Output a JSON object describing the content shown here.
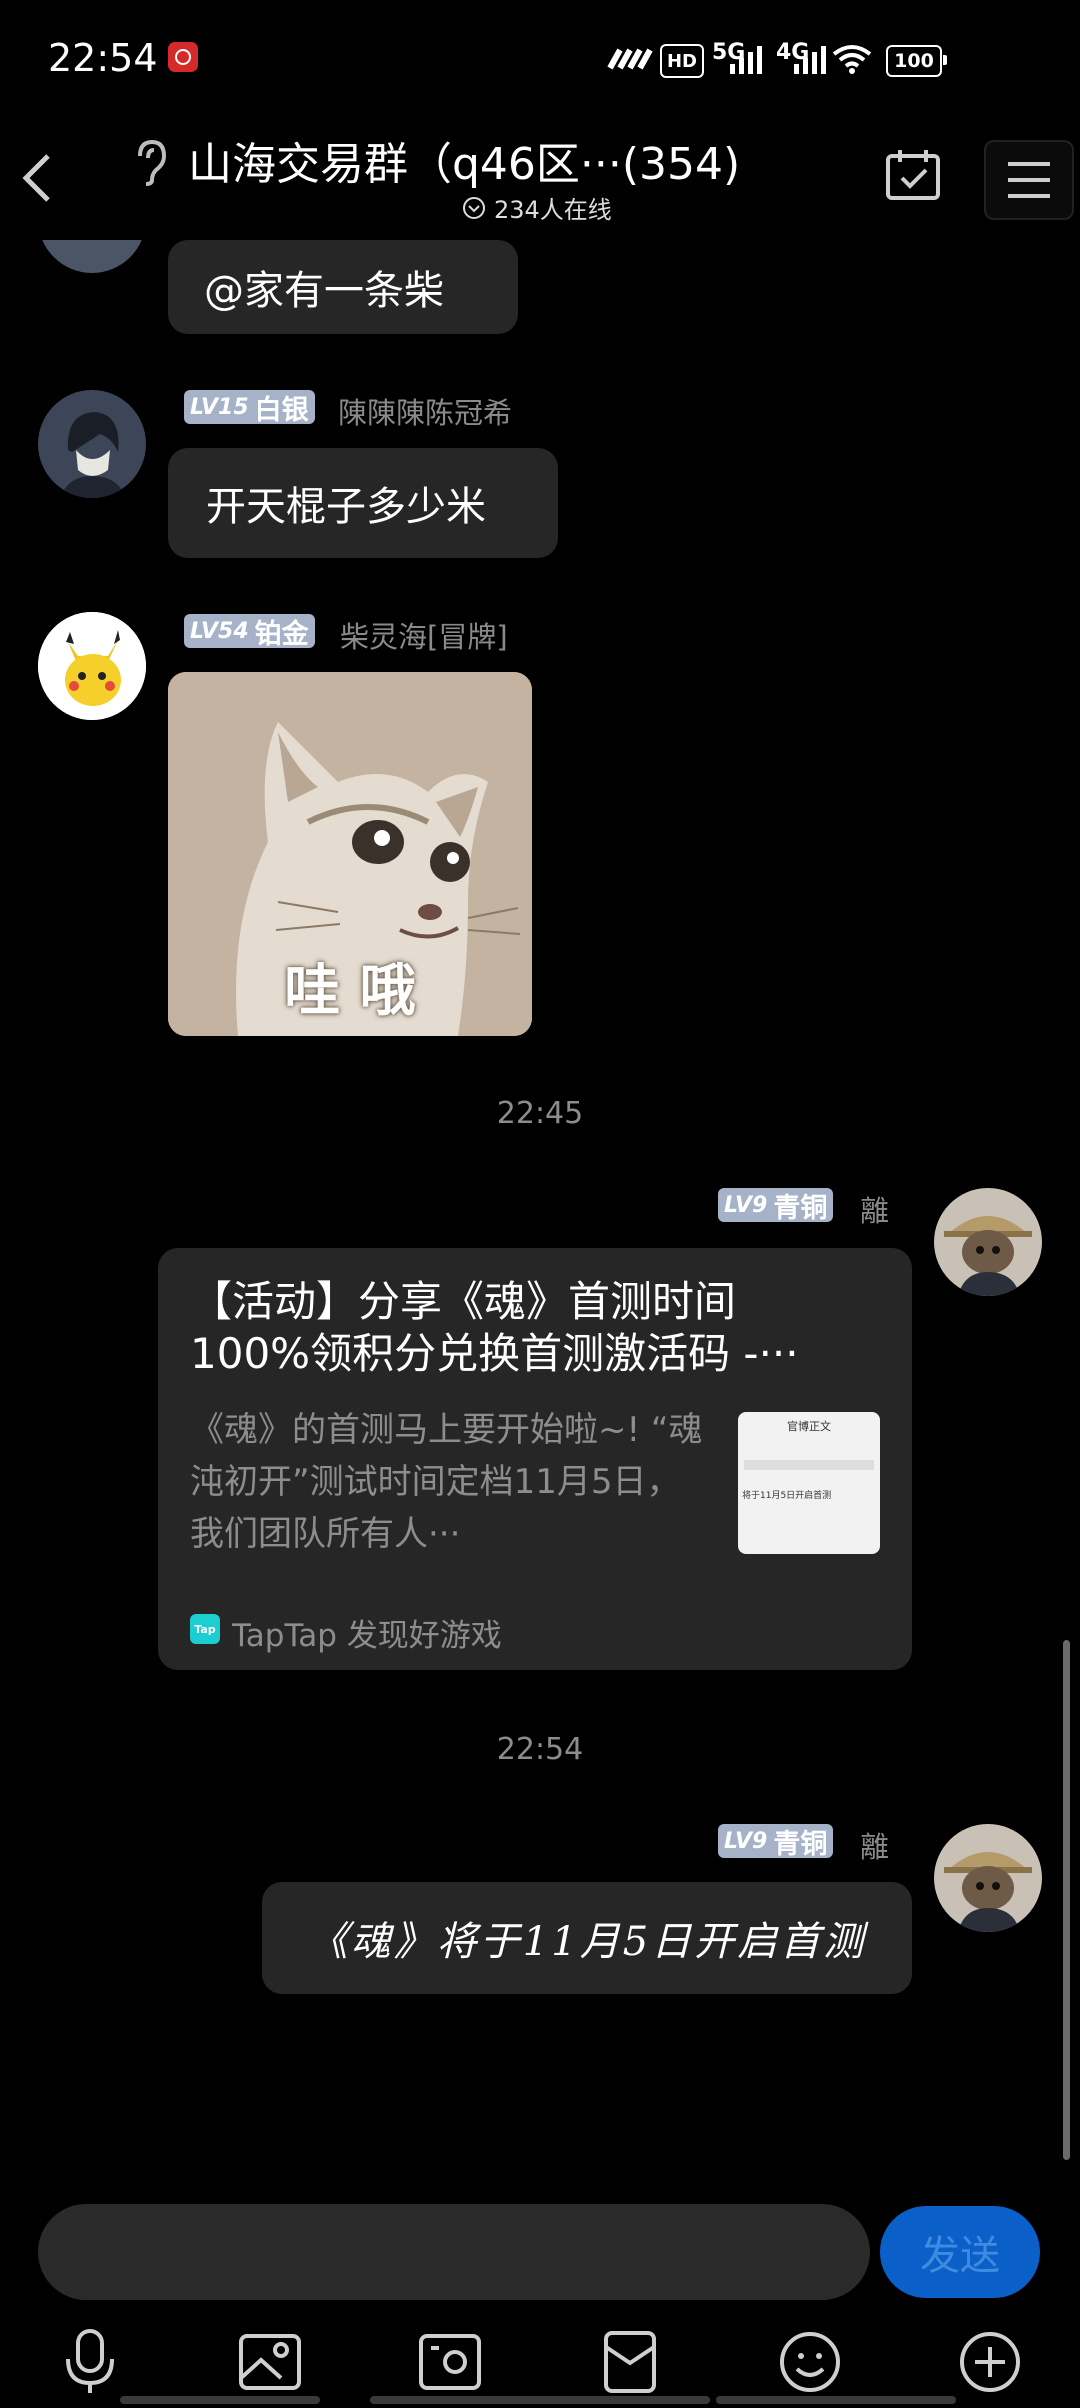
{
  "status_bar": {
    "time": "22:54",
    "network_hd": "HD",
    "network_5g": "5G",
    "network_4g": "4G",
    "battery": "100"
  },
  "header": {
    "title": "山海交易群（q46区···(354)",
    "online": "234人在线"
  },
  "messages": [
    {
      "text": "@家有一条柴"
    },
    {
      "level": "LV15",
      "rank": "白银",
      "nick": "陳陳陳陈冠希",
      "text": "开天棍子多少米"
    },
    {
      "level": "LV54",
      "rank": "铂金",
      "nick": "柴灵海[冒牌]",
      "sticker_text": "哇 哦"
    },
    {
      "time": "22:45"
    },
    {
      "level": "LV9",
      "rank": "青铜",
      "nick": "離",
      "card": {
        "title": "【活动】分享《魂》首测时间100%领积分兑换首测激活码 -···",
        "desc": "《魂》的首测马上要开始啦~! “魂沌初开”测试时间定档11月5日，我们团队所有人···",
        "source": "TapTap 发现好游戏",
        "source_icon": "Tap",
        "thumb_title": "官博正文",
        "thumb_line": "将于11月5日开启首测"
      }
    },
    {
      "time": "22:54"
    },
    {
      "level": "LV9",
      "rank": "青铜",
      "nick": "離",
      "text": "《魂》将于11月5日开启首测"
    }
  ],
  "input": {
    "send_label": "发送"
  },
  "colors": {
    "accent": "#0a5fc8",
    "badge": "#a6b2c8",
    "bubble": "#262626"
  }
}
